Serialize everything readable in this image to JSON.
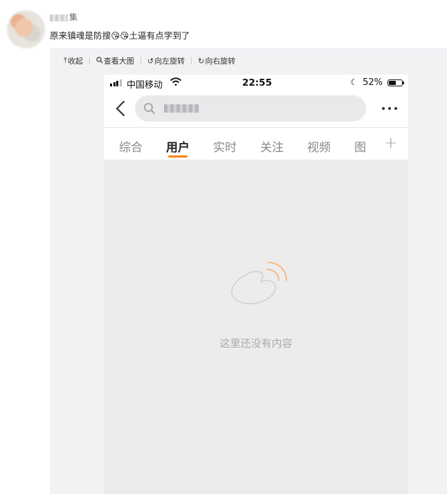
{
  "post": {
    "username_suffix": "集",
    "text": "原来镇魂是防搜😘😘土逼有点学到了"
  },
  "toolbar": {
    "items": [
      {
        "icon": "collapse-icon",
        "label": "收起"
      },
      {
        "icon": "magnify-icon",
        "label": "查看大图"
      },
      {
        "icon": "rotate-left-icon",
        "label": "向左旋转"
      },
      {
        "icon": "rotate-right-icon",
        "label": "向右旋转"
      }
    ]
  },
  "phone": {
    "status": {
      "carrier": "中国移动",
      "time": "22:55",
      "battery": "52%",
      "battery_level": 0.52
    },
    "tabs": [
      {
        "label": "综合",
        "active": false
      },
      {
        "label": "用户",
        "active": true
      },
      {
        "label": "实时",
        "active": false
      },
      {
        "label": "关注",
        "active": false
      },
      {
        "label": "视频",
        "active": false
      },
      {
        "label": "图",
        "active": false
      }
    ],
    "plus": "+",
    "empty_message": "这里还没有内容"
  },
  "colors": {
    "accent": "#ff8200",
    "panel": "#f2f2f5",
    "empty_bg": "#ececec"
  }
}
